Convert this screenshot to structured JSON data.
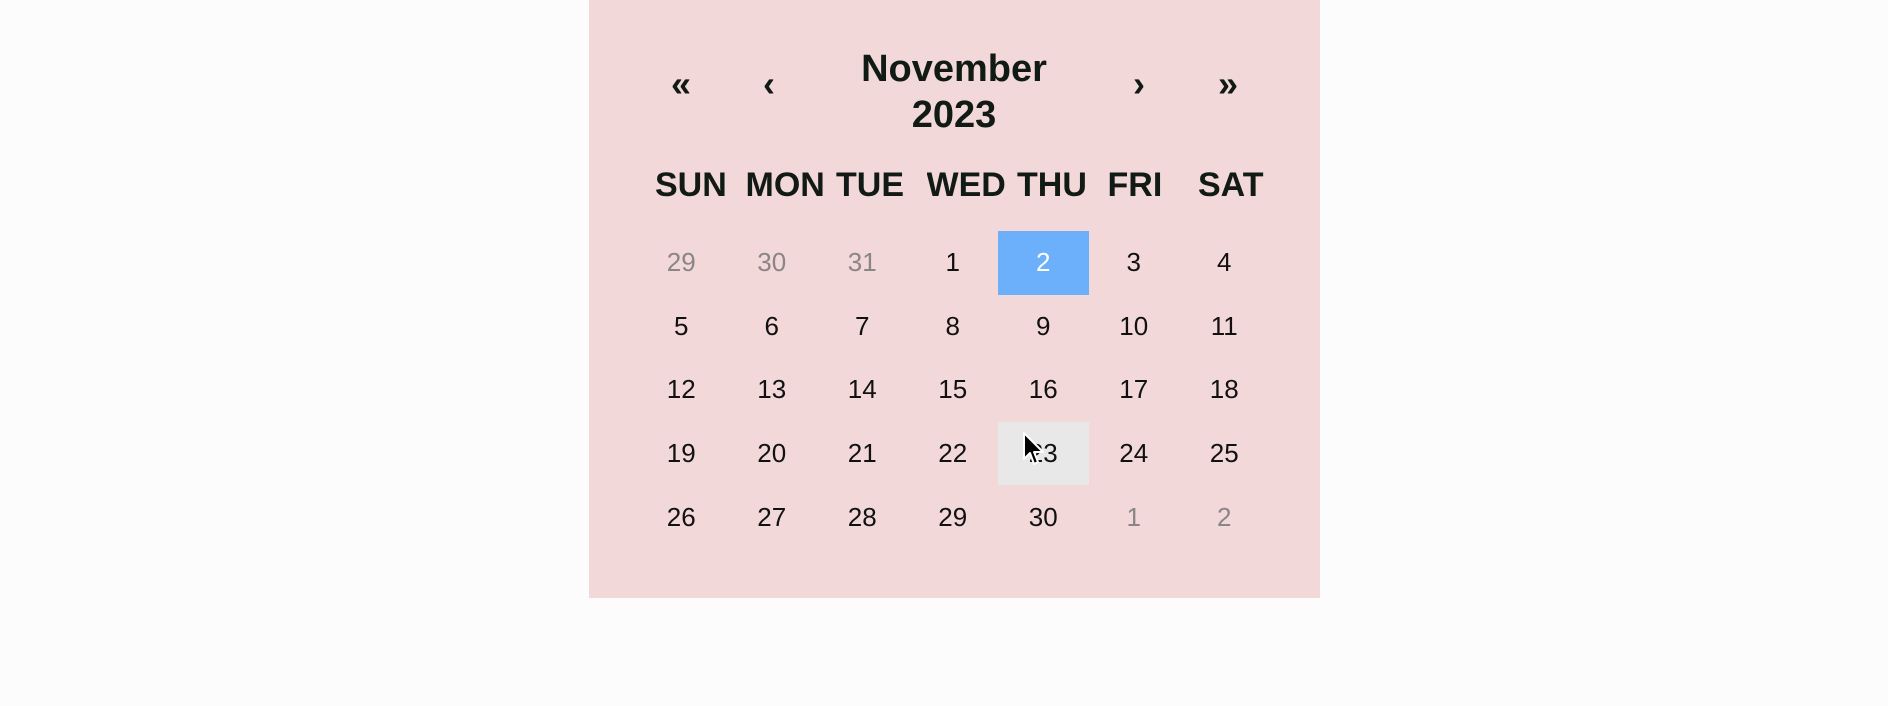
{
  "calendar": {
    "nav": {
      "prev_year": "«",
      "prev_month": "‹",
      "label_month": "November",
      "label_year": "2023",
      "next_month": "›",
      "next_year": "»"
    },
    "weekdays": [
      "SUN",
      "MON",
      "TUE",
      "WED",
      "THU",
      "FRI",
      "SAT"
    ],
    "weeks": [
      [
        "29",
        "30",
        "31",
        "1",
        "2",
        "3",
        "4"
      ],
      [
        "5",
        "6",
        "7",
        "8",
        "9",
        "10",
        "11"
      ],
      [
        "12",
        "13",
        "14",
        "15",
        "16",
        "17",
        "18"
      ],
      [
        "19",
        "20",
        "21",
        "22",
        "23",
        "24",
        "25"
      ],
      [
        "26",
        "27",
        "28",
        "29",
        "30",
        "1",
        "2"
      ]
    ],
    "outside_days": [
      [
        0,
        0
      ],
      [
        0,
        1
      ],
      [
        0,
        2
      ],
      [
        4,
        5
      ],
      [
        4,
        6
      ]
    ],
    "selected_day": [
      0,
      4
    ],
    "hovered_day": [
      3,
      4
    ],
    "colors": {
      "background": "#f2d8d9",
      "selected": "#6cb0fc",
      "hover": "#e8e8e8",
      "outside_text": "#8a8586"
    },
    "cursor_icon": "mouse-pointer-icon"
  }
}
